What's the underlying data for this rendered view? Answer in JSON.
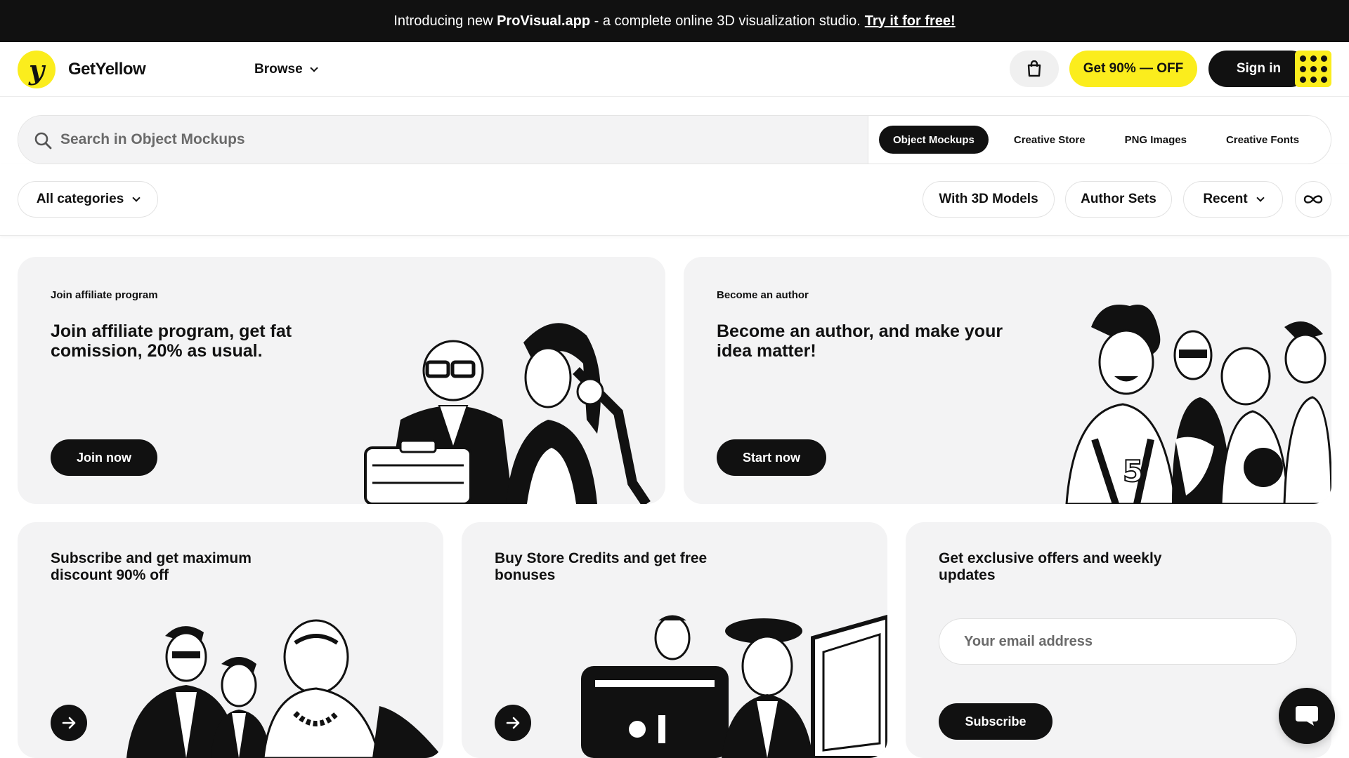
{
  "announcement": {
    "prefix": "Introducing new",
    "product": "ProVisual.app",
    "suffix": "- a complete online 3D visualization studio.",
    "cta": "Try it for free!"
  },
  "header": {
    "logo_letter": "y",
    "brand": "GetYellow",
    "browse": "Browse",
    "promo": "Get 90% — OFF",
    "signin": "Sign in"
  },
  "search": {
    "placeholder": "Search in Object Mockups",
    "tabs": [
      "Object Mockups",
      "Creative Store",
      "PNG Images",
      "Creative Fonts"
    ],
    "active_tab": "Object Mockups"
  },
  "filters": {
    "categories": "All categories",
    "with_3d": "With 3D Models",
    "author_sets": "Author Sets",
    "sort": "Recent"
  },
  "cards": {
    "affiliate": {
      "tag": "Join affiliate program",
      "title": "Join affiliate program, get fat comission, 20% as usual.",
      "button": "Join now"
    },
    "author": {
      "tag": "Become an author",
      "title": "Become an author, and make your idea matter!",
      "button": "Start now"
    },
    "subscribe": {
      "title": "Subscribe and get maximum discount 90% off"
    },
    "credits": {
      "title": "Buy Store Credits and get free bonuses"
    },
    "newsletter": {
      "title": "Get exclusive offers and weekly updates",
      "email_placeholder": "Your email address",
      "button": "Subscribe"
    }
  },
  "colors": {
    "accent": "#fbed1d",
    "dark": "#111111",
    "card_bg": "#f3f3f4"
  }
}
